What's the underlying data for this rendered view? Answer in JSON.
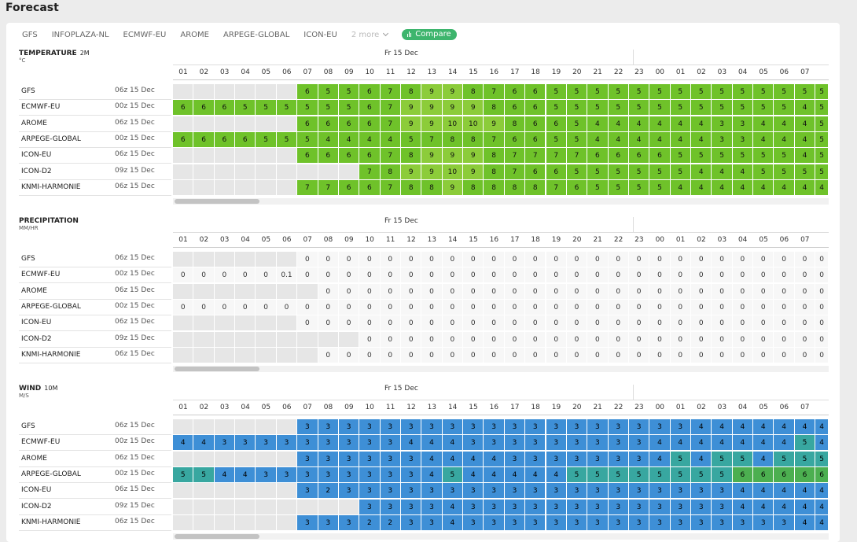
{
  "page": {
    "title": "Forecast"
  },
  "tabs": [
    "GFS",
    "INFOPLAZA-NL",
    "ECMWF-EU",
    "AROME",
    "ARPEGE-GLOBAL",
    "ICON-EU"
  ],
  "more_label": "2 more",
  "compare_label": "Compare",
  "hours": [
    "01",
    "02",
    "03",
    "04",
    "05",
    "06",
    "07",
    "08",
    "09",
    "10",
    "11",
    "12",
    "13",
    "14",
    "15",
    "16",
    "17",
    "18",
    "19",
    "20",
    "21",
    "22",
    "23",
    "00",
    "01",
    "02",
    "03",
    "04",
    "05",
    "06",
    "07",
    "08"
  ],
  "dates": [
    "Fr 15 Dec"
  ],
  "colors": {
    "temp": "#6fc22a",
    "temp_light": "#8ccc3a",
    "precip": "#f7f7f7",
    "wind": "#3e8fd6",
    "wind_teal": "#38a7a0",
    "wind_green": "#4caf50",
    "empty": "#e6e6e6",
    "compare": "#3db56d"
  },
  "sections": [
    {
      "id": "temperature",
      "title": "TEMPERATURE",
      "level": "2M",
      "unit": "°C",
      "kind": "temp",
      "rows": [
        {
          "model": "GFS",
          "run": "06z 15 Dec",
          "values": [
            null,
            null,
            null,
            null,
            null,
            null,
            6,
            5,
            5,
            6,
            7,
            8,
            9,
            9,
            8,
            7,
            6,
            6,
            5,
            5,
            5,
            5,
            5,
            5,
            5,
            5,
            5,
            5,
            5,
            5,
            5,
            5
          ]
        },
        {
          "model": "ECMWF-EU",
          "run": "00z 15 Dec",
          "values": [
            6,
            6,
            6,
            5,
            5,
            5,
            5,
            5,
            5,
            6,
            7,
            9,
            9,
            9,
            9,
            8,
            6,
            6,
            5,
            5,
            5,
            5,
            5,
            5,
            5,
            5,
            5,
            5,
            5,
            5,
            4,
            5
          ]
        },
        {
          "model": "AROME",
          "run": "06z 15 Dec",
          "values": [
            null,
            null,
            null,
            null,
            null,
            null,
            6,
            6,
            6,
            6,
            7,
            9,
            9,
            10,
            10,
            9,
            8,
            6,
            6,
            5,
            4,
            4,
            4,
            4,
            4,
            4,
            3,
            3,
            4,
            4,
            4,
            5
          ]
        },
        {
          "model": "ARPEGE-GLOBAL",
          "run": "00z 15 Dec",
          "values": [
            6,
            6,
            6,
            6,
            5,
            5,
            5,
            4,
            4,
            4,
            4,
            5,
            7,
            8,
            8,
            7,
            6,
            6,
            5,
            5,
            4,
            4,
            4,
            4,
            4,
            4,
            3,
            3,
            4,
            4,
            4,
            5
          ]
        },
        {
          "model": "ICON-EU",
          "run": "06z 15 Dec",
          "values": [
            null,
            null,
            null,
            null,
            null,
            null,
            6,
            6,
            6,
            6,
            7,
            8,
            9,
            9,
            9,
            8,
            7,
            7,
            7,
            7,
            6,
            6,
            6,
            6,
            5,
            5,
            5,
            5,
            5,
            5,
            4,
            5
          ]
        },
        {
          "model": "ICON-D2",
          "run": "09z 15 Dec",
          "values": [
            null,
            null,
            null,
            null,
            null,
            null,
            null,
            null,
            null,
            7,
            8,
            9,
            9,
            10,
            9,
            8,
            7,
            6,
            6,
            5,
            5,
            5,
            5,
            5,
            5,
            4,
            4,
            4,
            5,
            5,
            5,
            5
          ]
        },
        {
          "model": "KNMI-HARMONIE",
          "run": "06z 15 Dec",
          "values": [
            null,
            null,
            null,
            null,
            null,
            null,
            7,
            7,
            6,
            6,
            7,
            8,
            8,
            9,
            8,
            8,
            8,
            8,
            7,
            6,
            5,
            5,
            5,
            5,
            4,
            4,
            4,
            4,
            4,
            4,
            4,
            4
          ]
        }
      ]
    },
    {
      "id": "precipitation",
      "title": "PRECIPITATION",
      "level": "",
      "unit": "MM/HR",
      "kind": "precip",
      "rows": [
        {
          "model": "GFS",
          "run": "06z 15 Dec",
          "values": [
            null,
            null,
            null,
            null,
            null,
            null,
            "0",
            "0",
            "0",
            "0",
            "0",
            "0",
            "0",
            "0",
            "0",
            "0",
            "0",
            "0",
            "0",
            "0",
            "0",
            "0",
            "0",
            "0",
            "0",
            "0",
            "0",
            "0",
            "0",
            "0",
            "0",
            "0"
          ]
        },
        {
          "model": "ECMWF-EU",
          "run": "00z 15 Dec",
          "values": [
            "0",
            "0",
            "0",
            "0",
            "0",
            "0.1",
            "0",
            "0",
            "0",
            "0",
            "0",
            "0",
            "0",
            "0",
            "0",
            "0",
            "0",
            "0",
            "0",
            "0",
            "0",
            "0",
            "0",
            "0",
            "0",
            "0",
            "0",
            "0",
            "0",
            "0",
            "0",
            "0"
          ]
        },
        {
          "model": "AROME",
          "run": "06z 15 Dec",
          "values": [
            null,
            null,
            null,
            null,
            null,
            null,
            null,
            "0",
            "0",
            "0",
            "0",
            "0",
            "0",
            "0",
            "0",
            "0",
            "0",
            "0",
            "0",
            "0",
            "0",
            "0",
            "0",
            "0",
            "0",
            "0",
            "0",
            "0",
            "0",
            "0",
            "0",
            "0"
          ]
        },
        {
          "model": "ARPEGE-GLOBAL",
          "run": "00z 15 Dec",
          "values": [
            "0",
            "0",
            "0",
            "0",
            "0",
            "0",
            "0",
            "0",
            "0",
            "0",
            "0",
            "0",
            "0",
            "0",
            "0",
            "0",
            "0",
            "0",
            "0",
            "0",
            "0",
            "0",
            "0",
            "0",
            "0",
            "0",
            "0",
            "0",
            "0",
            "0",
            "0",
            "0"
          ]
        },
        {
          "model": "ICON-EU",
          "run": "06z 15 Dec",
          "values": [
            null,
            null,
            null,
            null,
            null,
            null,
            "0",
            "0",
            "0",
            "0",
            "0",
            "0",
            "0",
            "0",
            "0",
            "0",
            "0",
            "0",
            "0",
            "0",
            "0",
            "0",
            "0",
            "0",
            "0",
            "0",
            "0",
            "0",
            "0",
            "0",
            "0",
            "0"
          ]
        },
        {
          "model": "ICON-D2",
          "run": "09z 15 Dec",
          "values": [
            null,
            null,
            null,
            null,
            null,
            null,
            null,
            null,
            null,
            "0",
            "0",
            "0",
            "0",
            "0",
            "0",
            "0",
            "0",
            "0",
            "0",
            "0",
            "0",
            "0",
            "0",
            "0",
            "0",
            "0",
            "0",
            "0",
            "0",
            "0",
            "0",
            "0"
          ]
        },
        {
          "model": "KNMI-HARMONIE",
          "run": "06z 15 Dec",
          "values": [
            null,
            null,
            null,
            null,
            null,
            null,
            null,
            "0",
            "0",
            "0",
            "0",
            "0",
            "0",
            "0",
            "0",
            "0",
            "0",
            "0",
            "0",
            "0",
            "0",
            "0",
            "0",
            "0",
            "0",
            "0",
            "0",
            "0",
            "0",
            "0",
            "0",
            "0"
          ]
        }
      ]
    },
    {
      "id": "wind",
      "title": "WIND",
      "level": "10M",
      "unit": "M/S",
      "kind": "wind",
      "rows": [
        {
          "model": "GFS",
          "run": "06z 15 Dec",
          "values": [
            null,
            null,
            null,
            null,
            null,
            null,
            3,
            3,
            3,
            3,
            3,
            3,
            3,
            3,
            3,
            3,
            3,
            3,
            3,
            3,
            3,
            3,
            3,
            3,
            3,
            4,
            4,
            4,
            4,
            4,
            4,
            4
          ]
        },
        {
          "model": "ECMWF-EU",
          "run": "00z 15 Dec",
          "values": [
            4,
            4,
            3,
            3,
            3,
            3,
            3,
            3,
            3,
            3,
            3,
            4,
            4,
            4,
            3,
            3,
            3,
            3,
            3,
            3,
            3,
            3,
            3,
            4,
            4,
            4,
            4,
            4,
            4,
            4,
            5,
            4
          ]
        },
        {
          "model": "AROME",
          "run": "06z 15 Dec",
          "values": [
            null,
            null,
            null,
            null,
            null,
            null,
            3,
            3,
            3,
            3,
            3,
            3,
            4,
            4,
            4,
            4,
            3,
            3,
            3,
            3,
            3,
            3,
            3,
            4,
            5,
            4,
            5,
            5,
            4,
            5,
            5,
            5
          ]
        },
        {
          "model": "ARPEGE-GLOBAL",
          "run": "00z 15 Dec",
          "values": [
            5,
            5,
            4,
            4,
            3,
            3,
            3,
            3,
            3,
            3,
            3,
            3,
            4,
            5,
            4,
            4,
            4,
            4,
            4,
            5,
            5,
            5,
            5,
            5,
            5,
            5,
            5,
            6,
            6,
            6,
            6,
            6
          ]
        },
        {
          "model": "ICON-EU",
          "run": "06z 15 Dec",
          "values": [
            null,
            null,
            null,
            null,
            null,
            null,
            3,
            2,
            3,
            3,
            3,
            3,
            3,
            3,
            3,
            3,
            3,
            3,
            3,
            3,
            3,
            3,
            3,
            3,
            3,
            3,
            3,
            4,
            4,
            4,
            4,
            4
          ]
        },
        {
          "model": "ICON-D2",
          "run": "09z 15 Dec",
          "values": [
            null,
            null,
            null,
            null,
            null,
            null,
            null,
            null,
            null,
            3,
            3,
            3,
            3,
            4,
            3,
            3,
            3,
            3,
            3,
            3,
            3,
            3,
            3,
            3,
            3,
            3,
            3,
            4,
            4,
            4,
            4,
            4
          ]
        },
        {
          "model": "KNMI-HARMONIE",
          "run": "06z 15 Dec",
          "values": [
            null,
            null,
            null,
            null,
            null,
            null,
            3,
            3,
            3,
            2,
            2,
            3,
            3,
            4,
            3,
            3,
            3,
            3,
            3,
            3,
            3,
            3,
            3,
            3,
            3,
            3,
            3,
            3,
            3,
            3,
            4,
            4
          ]
        }
      ]
    }
  ]
}
